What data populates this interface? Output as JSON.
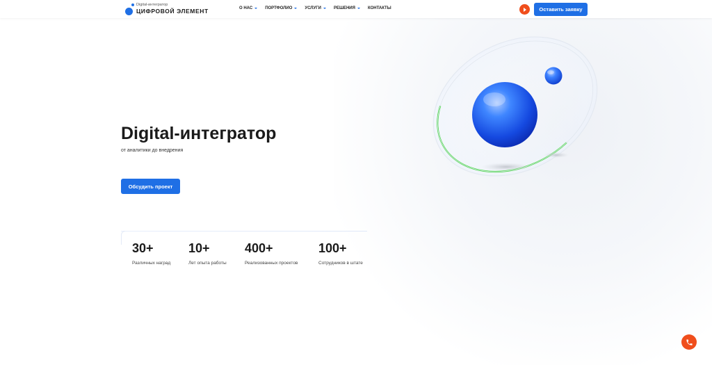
{
  "header": {
    "logo_subtitle": "Digital-интегратор",
    "logo_title": "ЦИФРОВОЙ ЭЛЕМЕНТ",
    "nav": [
      {
        "label": "О НАС",
        "has_dropdown": true
      },
      {
        "label": "ПОРТФОЛИО",
        "has_dropdown": true
      },
      {
        "label": "УСЛУГИ",
        "has_dropdown": true
      },
      {
        "label": "РЕШЕНИЯ",
        "has_dropdown": true
      },
      {
        "label": "КОНТАКТЫ",
        "has_dropdown": false
      }
    ],
    "play_icon": "play-icon",
    "cta_label": "Оставить заявку"
  },
  "hero": {
    "title": "Digital-интегратор",
    "subtitle": "от аналитики до внедрения",
    "button_label": "Обсудить проект"
  },
  "stats": [
    {
      "value": "30+",
      "label": "Различных наград"
    },
    {
      "value": "10+",
      "label": "Лет опыта работы"
    },
    {
      "value": "400+",
      "label": "Реализованных проектов"
    },
    {
      "value": "100+",
      "label": "Сотрудников в штате"
    }
  ],
  "floating": {
    "phone_icon": "phone-icon"
  },
  "colors": {
    "accent": "#1f6fe5",
    "orange": "#f04e1c",
    "orbit_green": "#4cd94a",
    "text": "#1a1a1a"
  }
}
